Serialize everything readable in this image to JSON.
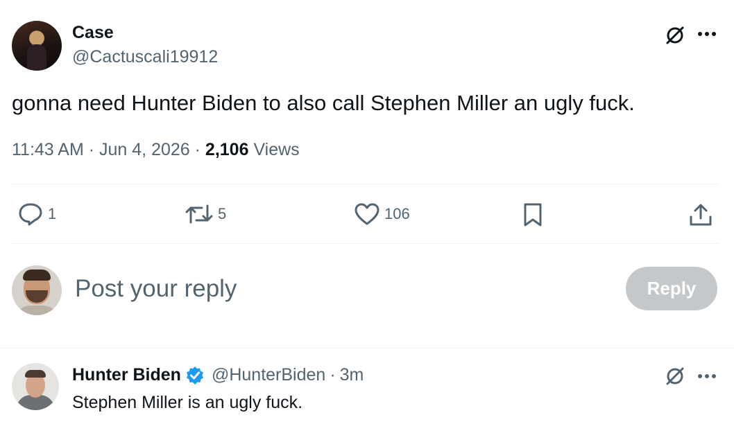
{
  "tweet": {
    "author_name": "Case",
    "author_handle": "@Cactuscali19912",
    "text": "gonna need Hunter Biden to also call Stephen Miller an ugly fuck.",
    "time": "11:43 AM",
    "date": "Jun 4, 2026",
    "views_count": "2,106",
    "views_label": "Views",
    "replies": "1",
    "retweets": "5",
    "likes": "106",
    "sep": "·"
  },
  "composer": {
    "placeholder": "Post your reply",
    "reply_label": "Reply"
  },
  "reply_tweet": {
    "author_name": "Hunter Biden",
    "author_handle": "@HunterBiden",
    "time_ago": "3m",
    "text": "Stephen Miller is an ugly fuck.",
    "sep": "·"
  },
  "colors": {
    "text_primary": "#0f1419",
    "text_secondary": "#536471",
    "verified_blue": "#1d9bf0",
    "reply_button_disabled": "#c4c8cb",
    "divider": "#eff3f4"
  },
  "icons": {
    "grok": "grok-icon",
    "more": "more-icon",
    "reply": "reply-icon",
    "retweet": "retweet-icon",
    "like": "heart-icon",
    "bookmark": "bookmark-icon",
    "share": "share-icon",
    "verified": "verified-badge-icon"
  }
}
